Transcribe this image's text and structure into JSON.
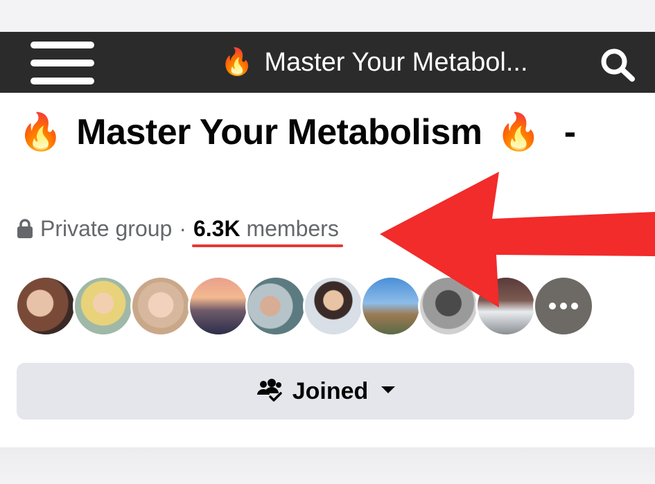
{
  "navbar": {
    "title_emoji": "🔥",
    "title": "Master Your Metabol...",
    "menu_icon": "hamburger-menu-icon",
    "search_icon": "search-icon"
  },
  "group": {
    "title_emoji": "🔥",
    "title": "Master Your Metabolism",
    "title_emoji_end": "🔥",
    "title_suffix": "-",
    "privacy": "Private group",
    "separator": "·",
    "member_count": "6.3K",
    "member_label": "members"
  },
  "members": {
    "avatars": [
      {
        "name": "member-avatar-1"
      },
      {
        "name": "member-avatar-2"
      },
      {
        "name": "member-avatar-3"
      },
      {
        "name": "member-avatar-4"
      },
      {
        "name": "member-avatar-5"
      },
      {
        "name": "member-avatar-6"
      },
      {
        "name": "member-avatar-7"
      },
      {
        "name": "member-avatar-8"
      },
      {
        "name": "member-avatar-9"
      }
    ],
    "more_icon": "more-dots-icon"
  },
  "actions": {
    "joined_label": "Joined",
    "joined_icon": "group-joined-icon",
    "dropdown_icon": "caret-down-icon"
  },
  "annotation": {
    "arrow_color": "#f22b2b",
    "underline_color": "#e53935"
  },
  "colors": {
    "navbar_bg": "#2b2b2b",
    "button_bg": "#e4e6eb",
    "muted_text": "#65676b"
  }
}
